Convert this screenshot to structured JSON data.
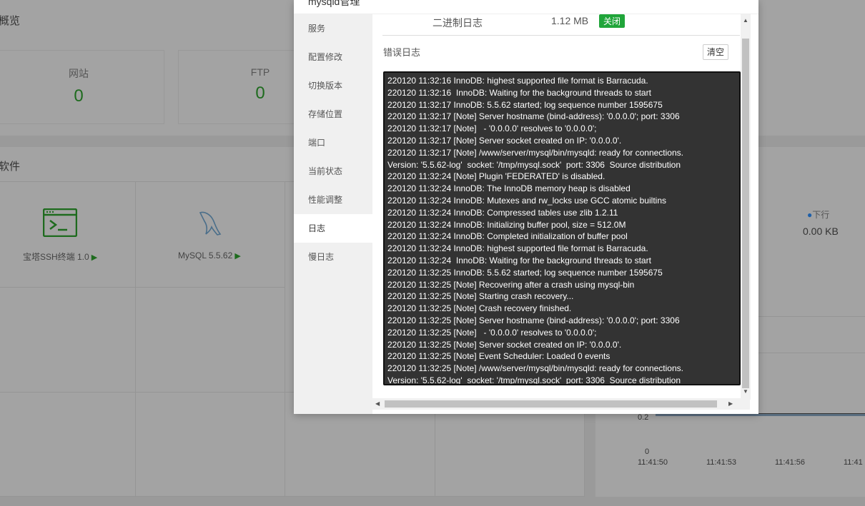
{
  "background": {
    "overview_title": "概览",
    "stats": [
      {
        "label": "网站",
        "value": "0"
      },
      {
        "label": "FTP",
        "value": "0"
      }
    ],
    "software_title": "软件",
    "software": [
      {
        "label": "宝塔SSH终端 1.0",
        "icon": "terminal-icon"
      },
      {
        "label": "MySQL 5.5.62",
        "icon": "mysql-dolphin-icon"
      }
    ],
    "traffic": {
      "legend": "下行",
      "value": "0.00 KB"
    },
    "chart": {
      "y_ticks": [
        "0.2",
        "0"
      ],
      "x_ticks": [
        "11:41:50",
        "11:41:53",
        "11:41:56",
        "11:41"
      ]
    }
  },
  "modal": {
    "title": "mysqld管理",
    "menu": [
      "服务",
      "配置修改",
      "切换版本",
      "存储位置",
      "端口",
      "当前状态",
      "性能调整",
      "日志",
      "慢日志"
    ],
    "active_menu": "日志",
    "binlog": {
      "name": "二进制日志",
      "size": "1.12 MB",
      "status": "关闭"
    },
    "errlog_title": "错误日志",
    "clear_label": "清空",
    "log_lines": [
      "220120 11:32:16 InnoDB: highest supported file format is Barracuda.",
      "220120 11:32:16  InnoDB: Waiting for the background threads to start",
      "220120 11:32:17 InnoDB: 5.5.62 started; log sequence number 1595675",
      "220120 11:32:17 [Note] Server hostname (bind-address): '0.0.0.0'; port: 3306",
      "220120 11:32:17 [Note]   - '0.0.0.0' resolves to '0.0.0.0';",
      "220120 11:32:17 [Note] Server socket created on IP: '0.0.0.0'.",
      "220120 11:32:17 [Note] /www/server/mysql/bin/mysqld: ready for connections.",
      "Version: '5.5.62-log'  socket: '/tmp/mysql.sock'  port: 3306  Source distribution",
      "220120 11:32:24 [Note] Plugin 'FEDERATED' is disabled.",
      "220120 11:32:24 InnoDB: The InnoDB memory heap is disabled",
      "220120 11:32:24 InnoDB: Mutexes and rw_locks use GCC atomic builtins",
      "220120 11:32:24 InnoDB: Compressed tables use zlib 1.2.11",
      "220120 11:32:24 InnoDB: Initializing buffer pool, size = 512.0M",
      "220120 11:32:24 InnoDB: Completed initialization of buffer pool",
      "220120 11:32:24 InnoDB: highest supported file format is Barracuda.",
      "220120 11:32:24  InnoDB: Waiting for the background threads to start",
      "220120 11:32:25 InnoDB: 5.5.62 started; log sequence number 1595675",
      "220120 11:32:25 [Note] Recovering after a crash using mysql-bin",
      "220120 11:32:25 [Note] Starting crash recovery...",
      "220120 11:32:25 [Note] Crash recovery finished.",
      "220120 11:32:25 [Note] Server hostname (bind-address): '0.0.0.0'; port: 3306",
      "220120 11:32:25 [Note]   - '0.0.0.0' resolves to '0.0.0.0';",
      "220120 11:32:25 [Note] Server socket created on IP: '0.0.0.0'.",
      "220120 11:32:25 [Note] Event Scheduler: Loaded 0 events",
      "220120 11:32:25 [Note] /www/server/mysql/bin/mysqld: ready for connections.",
      "Version: '5.5.62-log'  socket: '/tmp/mysql.sock'  port: 3306  Source distribution"
    ]
  }
}
